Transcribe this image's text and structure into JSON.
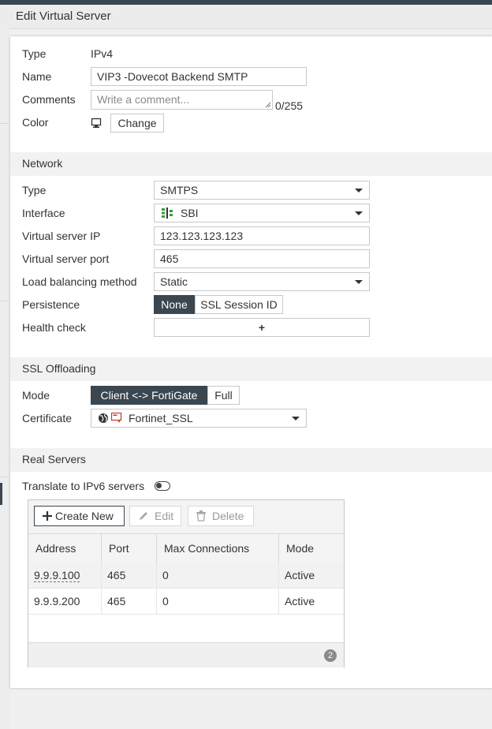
{
  "window": {
    "title": "Edit Virtual Server"
  },
  "general": {
    "type_label": "Type",
    "type_value": "IPv4",
    "name_label": "Name",
    "name_value": "VIP3 -Dovecot Backend SMTP",
    "comments_label": "Comments",
    "comments_placeholder": "Write a comment...",
    "comments_count": "0/255",
    "color_label": "Color",
    "color_change": "Change"
  },
  "network": {
    "title": "Network",
    "type_label": "Type",
    "type_value": "SMTPS",
    "interface_label": "Interface",
    "interface_value": "SBI",
    "ip_label": "Virtual server IP",
    "ip_value": "123.123.123.123",
    "port_label": "Virtual server port",
    "port_value": "465",
    "lb_label": "Load balancing method",
    "lb_value": "Static",
    "persistence_label": "Persistence",
    "persistence_options": [
      "None",
      "SSL Session ID"
    ],
    "persistence_selected": "None",
    "health_label": "Health check",
    "health_add": "+"
  },
  "ssl": {
    "title": "SSL Offloading",
    "mode_label": "Mode",
    "mode_options": [
      "Client <-> FortiGate",
      "Full"
    ],
    "mode_selected": "Client <-> FortiGate",
    "cert_label": "Certificate",
    "cert_value": "Fortinet_SSL"
  },
  "real_servers": {
    "title": "Real Servers",
    "ipv6_label": "Translate to IPv6 servers",
    "ipv6_enabled": false,
    "toolbar": {
      "create": "Create New",
      "edit": "Edit",
      "delete": "Delete"
    },
    "columns": [
      "Address",
      "Port",
      "Max Connections",
      "Mode"
    ],
    "rows": [
      {
        "address": "9.9.9.100",
        "port": "465",
        "max": "0",
        "mode": "Active"
      },
      {
        "address": "9.9.9.200",
        "port": "465",
        "max": "0",
        "mode": "Active"
      }
    ],
    "count": "2"
  },
  "colors": {
    "accent": "#3a4650",
    "interface_icon": "#3a9a3a",
    "cert_icon": "#c0392b"
  }
}
